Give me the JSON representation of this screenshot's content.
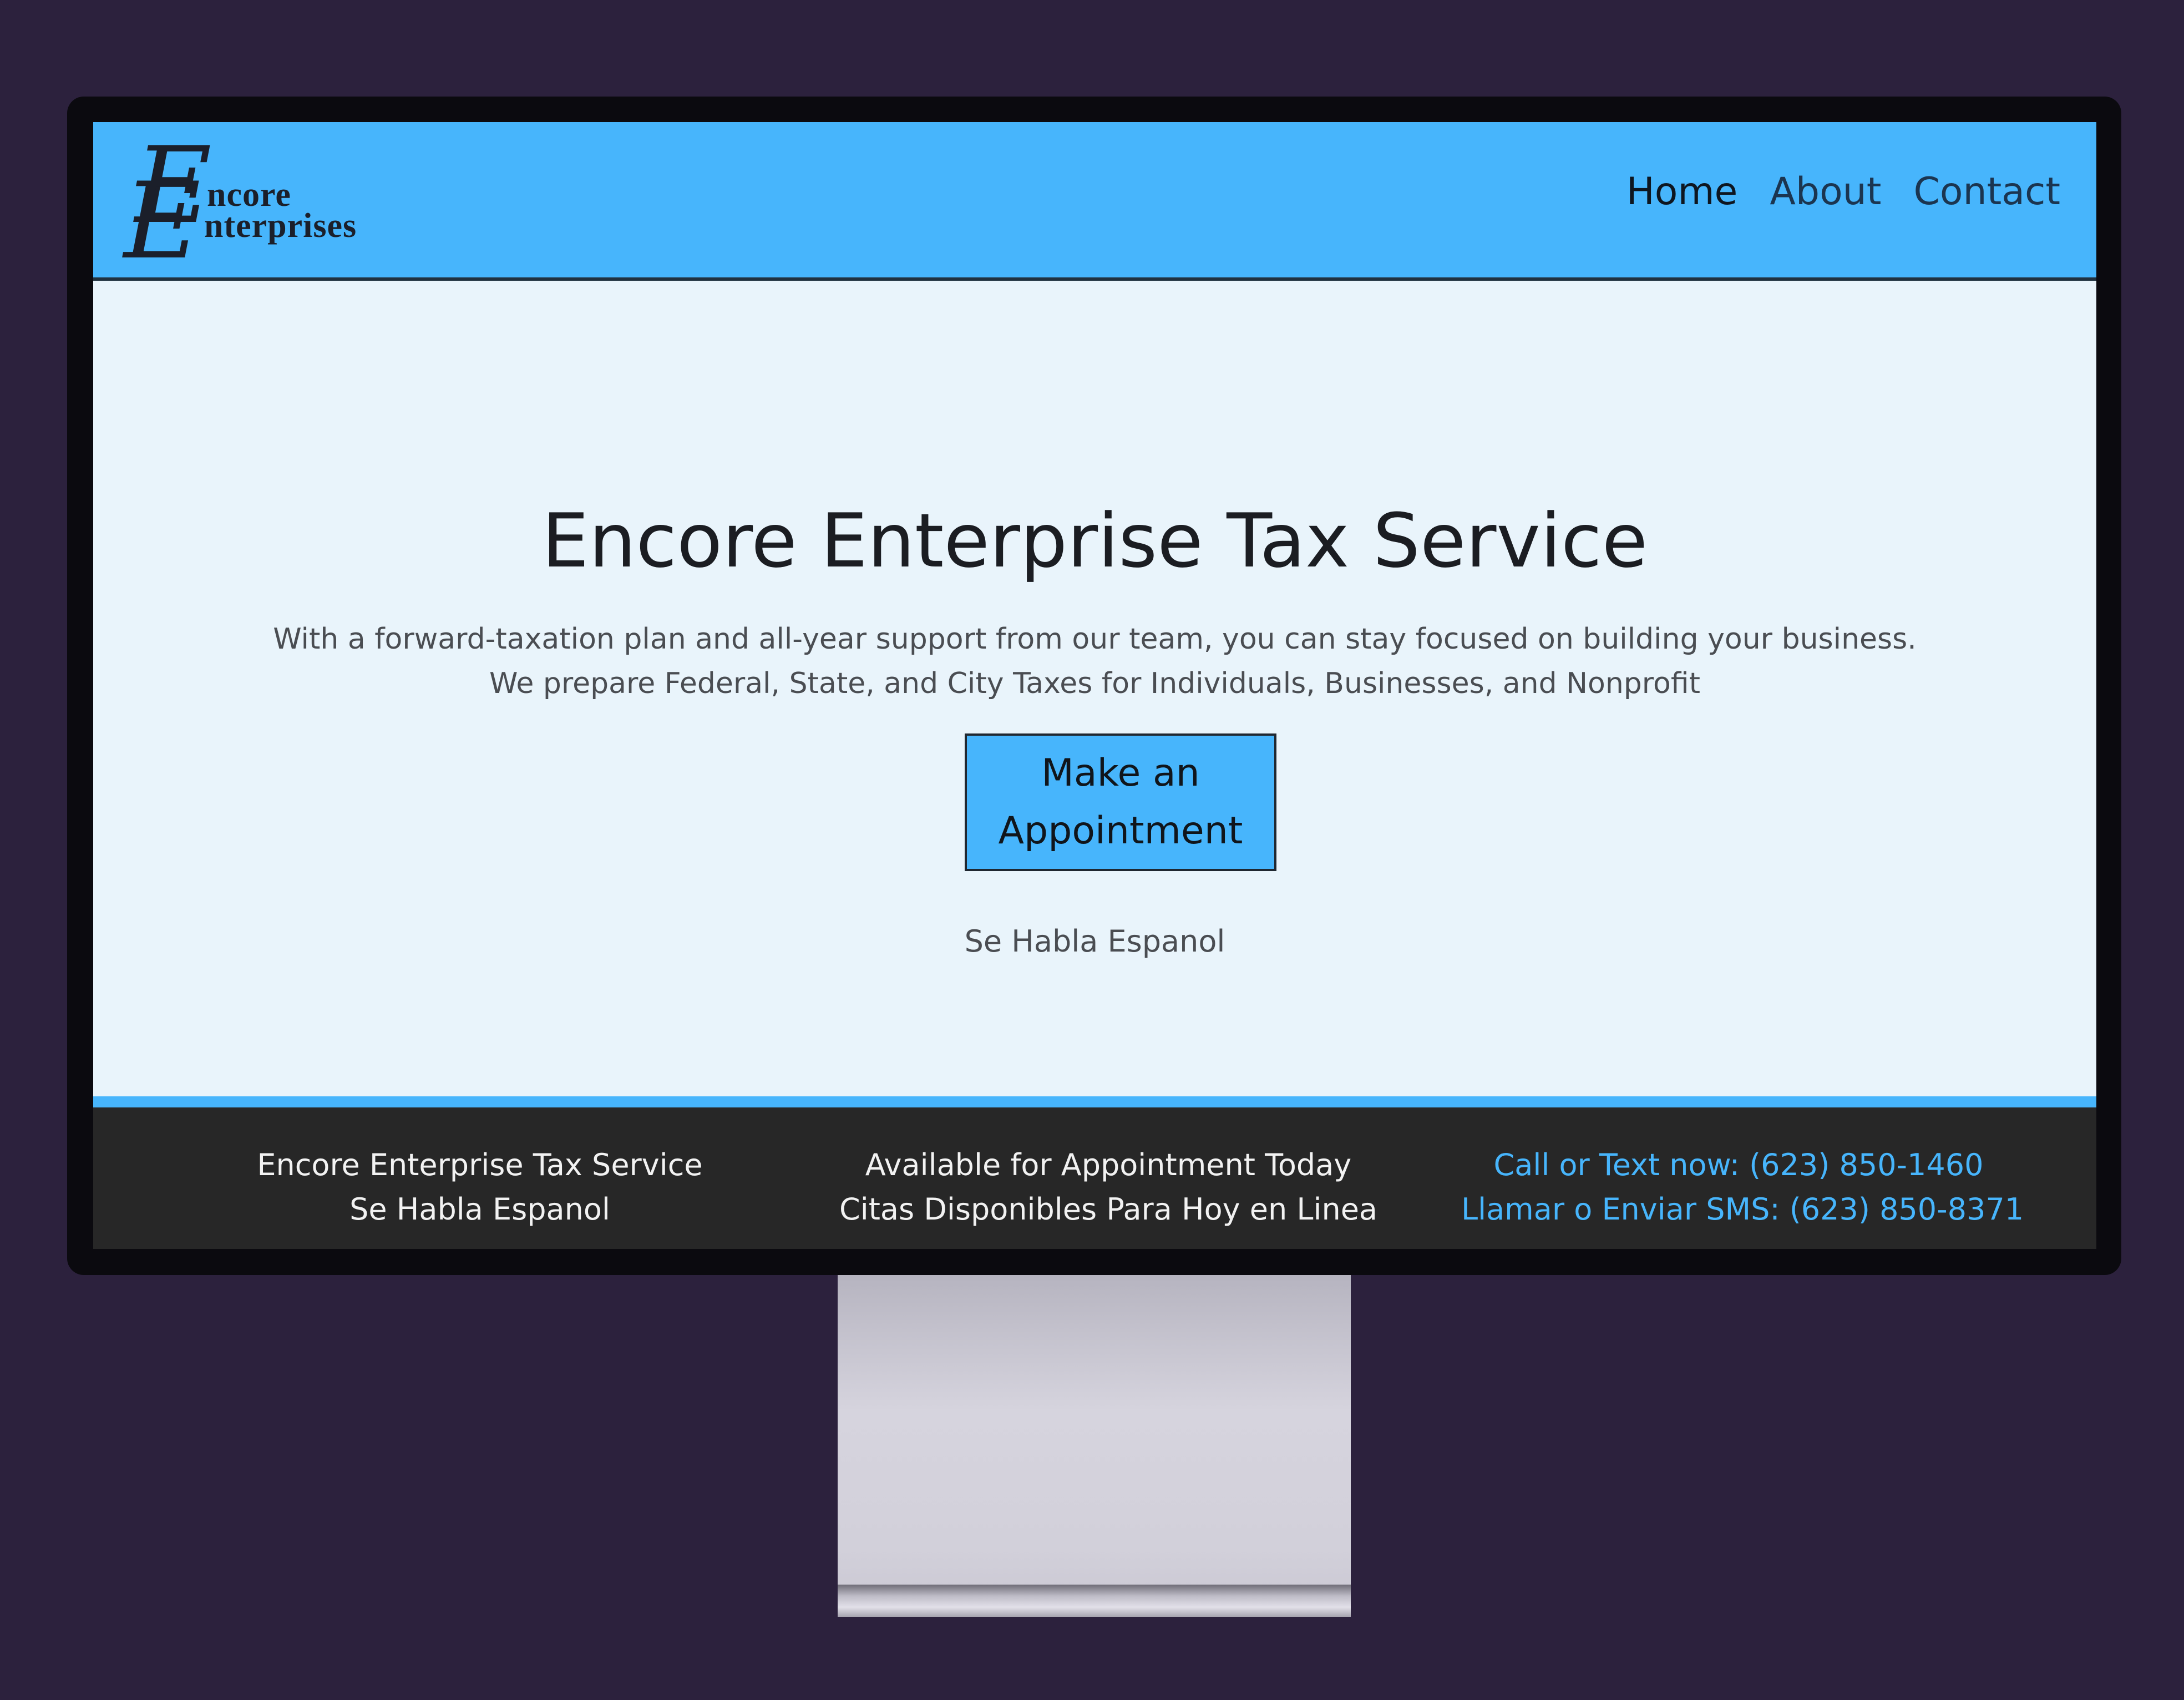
{
  "brand": {
    "logo_letter_1": "E",
    "logo_letter_2": "E",
    "logo_line_1": "ncore",
    "logo_line_2": "nterprises"
  },
  "nav": {
    "items": [
      {
        "label": "Home",
        "active": true
      },
      {
        "label": "About",
        "active": false
      },
      {
        "label": "Contact",
        "active": false
      }
    ]
  },
  "hero": {
    "title": "Encore Enterprise Tax Service",
    "line_1": "With a forward-taxation plan and all-year support from our team, you can stay focused on building your business.",
    "line_2": "We prepare Federal, State, and City Taxes for Individuals, Businesses, and Nonprofit",
    "button_line_1": "Make an",
    "button_line_2": "Appointment",
    "spanish_note": "Se Habla Espanol"
  },
  "footer": {
    "col_1": {
      "line_1": "Encore Enterprise Tax Service",
      "line_2": "Se Habla Espanol"
    },
    "col_2": {
      "line_1": "Available for Appointment Today",
      "line_2": "Citas Disponibles Para Hoy en Linea"
    },
    "col_3": {
      "line_1": "Call or Text now: (623) 850-1460",
      "line_2": "Llamar o Enviar SMS: (623) 850-8371"
    }
  },
  "colors": {
    "background": "#2c213d",
    "accent_blue": "#47b5fc",
    "page_bg": "#e9f4fb",
    "footer_bg": "#272727"
  }
}
